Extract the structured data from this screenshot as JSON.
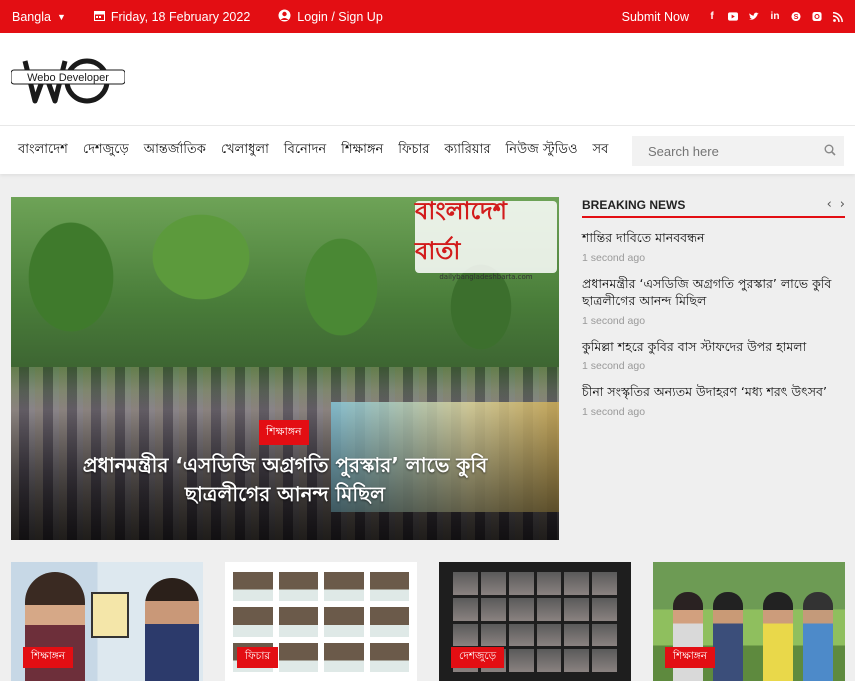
{
  "topbar": {
    "language": "Bangla",
    "date": "Friday, 18 February 2022",
    "login": "Login / Sign Up",
    "submit": "Submit Now",
    "social": [
      "facebook-icon",
      "youtube-icon",
      "twitter-icon",
      "linkedin-icon",
      "skype-icon",
      "instagram-icon",
      "rss-icon"
    ]
  },
  "header": {
    "logo_text": "Webo Developer"
  },
  "nav": {
    "items": [
      "বাংলাদেশ",
      "দেশজুড়ে",
      "আন্তর্জাতিক",
      "খেলাধুলা",
      "বিনোদন",
      "শিক্ষাঙ্গন",
      "ফিচার",
      "ক্যারিয়ার",
      "নিউজ স্টুডিও",
      "সব"
    ],
    "search_placeholder": "Search here"
  },
  "hero": {
    "tag": "শিক্ষাঙ্গন",
    "title": "প্রধানমন্ত্রীর ‘এসডিজি অগ্রগতি পুরস্কার’ লাভে কুবি ছাত্রলীগের আনন্দ মিছিল",
    "watermark": "বাংলাদেশ বার্তা",
    "watermark_small": "dailybangladeshbarta.com"
  },
  "breaking": {
    "title": "BREAKING NEWS",
    "items": [
      {
        "title": "শান্তির দাবিতে মানববন্ধন",
        "time": "1 second ago"
      },
      {
        "title": "প্রধানমন্ত্রীর ‘এসডিজি অগ্রগতি পুরস্কার’ লাভে কুবি ছাত্রলীগের আনন্দ মিছিল",
        "time": "1 second ago"
      },
      {
        "title": "কুমিল্লা শহরে কুবির বাস স্টাফদের উপর হামলা",
        "time": "1 second ago"
      },
      {
        "title": "চীনা সংস্কৃতির অন্যতম উদাহরণ ‘মধ্য শরৎ উৎসব’",
        "time": "1 second ago"
      }
    ]
  },
  "cards": [
    {
      "tag": "শিক্ষাঙ্গন"
    },
    {
      "tag": "ফিচার"
    },
    {
      "tag": "দেশজুড়ে"
    },
    {
      "tag": "শিক্ষাঙ্গন"
    }
  ],
  "colors": {
    "accent": "#e30e13"
  }
}
